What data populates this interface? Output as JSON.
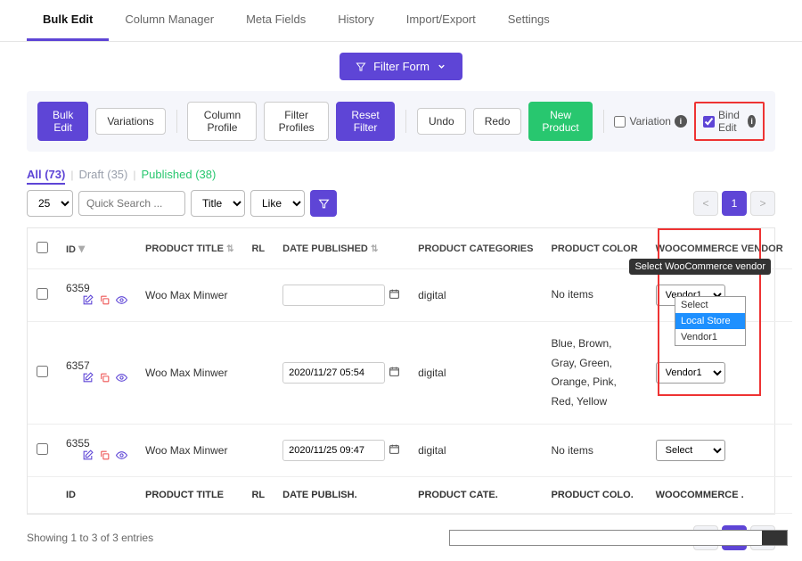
{
  "tabs": [
    "Bulk Edit",
    "Column Manager",
    "Meta Fields",
    "History",
    "Import/Export",
    "Settings"
  ],
  "activeTab": 0,
  "filterForm": "Filter Form",
  "toolbar": {
    "bulkEdit": "Bulk Edit",
    "variations": "Variations",
    "columnProfile": "Column Profile",
    "filterProfiles": "Filter Profiles",
    "resetFilter": "Reset Filter",
    "undo": "Undo",
    "redo": "Redo",
    "newProduct": "New Product",
    "variation": "Variation",
    "bindEdit": "Bind Edit"
  },
  "statuses": [
    {
      "label": "All (73)",
      "cls": "status-active"
    },
    {
      "label": "Draft (35)",
      "cls": "status-draft"
    },
    {
      "label": "Published (38)",
      "cls": "status-published"
    }
  ],
  "perPage": "25",
  "quickSearchPlaceholder": "Quick Search ...",
  "titleSel": "Title",
  "likeSel": "Like",
  "pagerPrev": "<",
  "pagerNext": ">",
  "pagerCurrent": "1",
  "columns": {
    "id": "ID",
    "productTitle": "PRODUCT TITLE",
    "rl": "RL",
    "datePublished": "DATE PUBLISHED",
    "productCategories": "PRODUCT CATEGORIES",
    "productColor": "PRODUCT COLOR",
    "wcVendor": "WOOCOMMERCE VENDOR"
  },
  "footerCols": {
    "id": "ID",
    "productTitle": "PRODUCT TITLE",
    "rl": "RL",
    "datePublished": "DATE PUBLISH.",
    "productCategories": "PRODUCT CATE.",
    "productColor": "PRODUCT COLO.",
    "wcVendor": "WOOCOMMERCE ."
  },
  "rows": [
    {
      "id": "6359",
      "title": "Woo Max Minwer",
      "date": "",
      "cat": "digital",
      "color": "No items",
      "vendor": "Vendor1"
    },
    {
      "id": "6357",
      "title": "Woo Max Minwer",
      "date": "2020/11/27 05:54",
      "cat": "digital",
      "color": "Blue, Brown, Gray, Green, Orange, Pink, Red, Yellow",
      "vendor": "Vendor1"
    },
    {
      "id": "6355",
      "title": "Woo Max Minwer",
      "date": "2020/11/25 09:47",
      "cat": "digital",
      "color": "No items",
      "vendor": "Select"
    }
  ],
  "tooltip": "Select WooCommerce vendor",
  "dropdown": [
    "Select",
    "Local Store",
    "Vendor1"
  ],
  "dropdownHighlight": 1,
  "footerInfo": "Showing 1 to 3 of 3 entries"
}
